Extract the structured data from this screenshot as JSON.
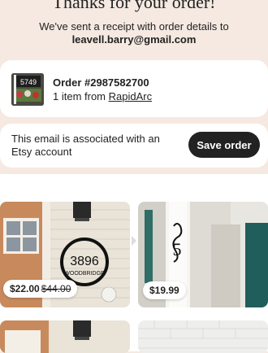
{
  "header": {
    "title": "Thanks for your order!",
    "subtitle": "We've sent a receipt with order details to",
    "email": "leavell.barry@gmail.com"
  },
  "order": {
    "number_label": "Order #2987582700",
    "items_prefix": "1 item from ",
    "shop_name": "RapidArc",
    "thumb_text": "5749"
  },
  "etsy_prompt": {
    "text": "This email is associated with an Etsy account",
    "button_label": "Save order"
  },
  "recommendations": [
    {
      "price": "$22.00",
      "original_price": "$44.00",
      "sign_number": "3896",
      "sign_street": "WOODBRIDGE"
    },
    {
      "price": "$19.99",
      "original_price": "",
      "sign_number": "5"
    }
  ],
  "colors": {
    "page_bg": "#f5e9e1",
    "button_bg": "#222222",
    "door_teal": "#1f5e5a"
  }
}
